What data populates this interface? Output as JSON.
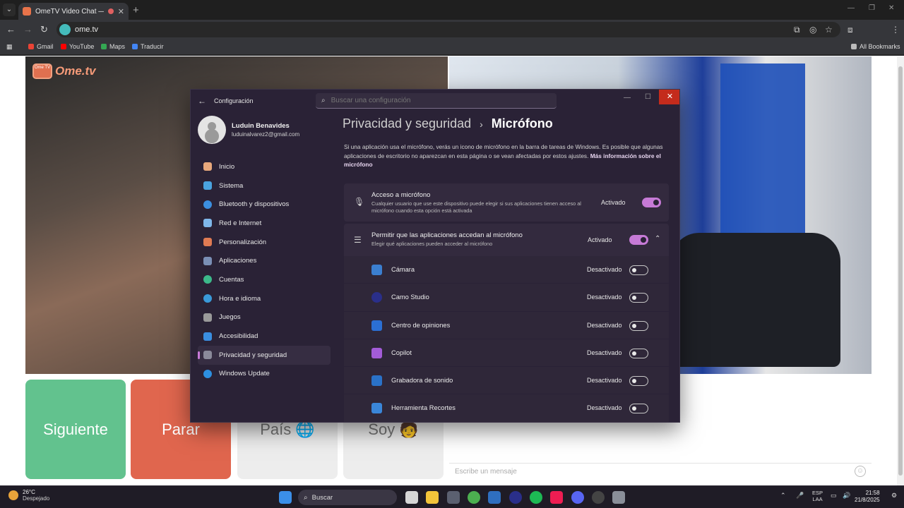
{
  "browser": {
    "tab_title": "OmeTV Video Chat — Om",
    "url": "ome.tv",
    "bookmarks": [
      {
        "label": "Gmail",
        "color": "#ea4335"
      },
      {
        "label": "YouTube",
        "color": "#ff0000"
      },
      {
        "label": "Maps",
        "color": "#34a853"
      },
      {
        "label": "Traducir",
        "color": "#4285f4"
      }
    ],
    "all_bookmarks": "All Bookmarks",
    "profile_initial": "L"
  },
  "site": {
    "logo_tv": "Ome TV",
    "logo_text": "Ome.tv",
    "buttons": {
      "next": "Siguiente",
      "stop": "Parar",
      "country": "País 🌐",
      "gender": "Soy 🧑"
    },
    "message_placeholder": "Escribe un mensaje"
  },
  "settings": {
    "app_title": "Configuración",
    "search_placeholder": "Buscar una configuración",
    "user": {
      "name": "Luduin Benavides",
      "email": "luduinalvarez2@gmail.com"
    },
    "nav": [
      {
        "label": "Inicio",
        "color": "#e8a87c"
      },
      {
        "label": "Sistema",
        "color": "#4aa3df"
      },
      {
        "label": "Bluetooth y dispositivos",
        "color": "#3c8fe0"
      },
      {
        "label": "Red e Internet",
        "color": "#7fb7ea"
      },
      {
        "label": "Personalización",
        "color": "#e07b53"
      },
      {
        "label": "Aplicaciones",
        "color": "#7a8fb5"
      },
      {
        "label": "Cuentas",
        "color": "#3cb98a"
      },
      {
        "label": "Hora e idioma",
        "color": "#3a9ad9"
      },
      {
        "label": "Juegos",
        "color": "#9a9a9a"
      },
      {
        "label": "Accesibilidad",
        "color": "#3a8ee0"
      },
      {
        "label": "Privacidad y seguridad",
        "color": "#8a8a9a",
        "active": true
      },
      {
        "label": "Windows Update",
        "color": "#2d8fe0"
      }
    ],
    "breadcrumb": {
      "parent": "Privacidad y seguridad",
      "separator": "›",
      "current": "Micrófono"
    },
    "description": "Si una aplicación usa el micrófono, verás un icono de micrófono en la barra de tareas de Windows. Es posible que algunas aplicaciones de escritorio no aparezcan en esta página o se vean afectadas por estos ajustes.",
    "description_link": "Más información sobre el micrófono",
    "mic_access": {
      "title": "Acceso a micrófono",
      "subtitle": "Cualquier usuario que use este dispositivo puede elegir si sus aplicaciones tienen acceso al micrófono cuando esta opción está activada",
      "state": "Activado",
      "on": true
    },
    "allow_apps": {
      "title": "Permitir que las aplicaciones accedan al micrófono",
      "subtitle": "Elegir qué aplicaciones pueden acceder al micrófono",
      "state": "Activado",
      "on": true
    },
    "apps": [
      {
        "name": "Cámara",
        "state": "Desactivado",
        "color": "#3b7fd0"
      },
      {
        "name": "Camo Studio",
        "state": "Desactivado",
        "color": "#2a2f8a"
      },
      {
        "name": "Centro de opiniones",
        "state": "Desactivado",
        "color": "#2b6fd3"
      },
      {
        "name": "Copilot",
        "state": "Desactivado",
        "color": "#a35cd8"
      },
      {
        "name": "Grabadora de sonido",
        "state": "Desactivado",
        "color": "#2a72c8"
      },
      {
        "name": "Herramienta Recortes",
        "state": "Desactivado",
        "color": "#3a86d9"
      }
    ]
  },
  "taskbar": {
    "temp": "26°C",
    "weather": "Despejado",
    "search": "Buscar",
    "lang_top": "ESP",
    "lang_bottom": "LAA",
    "time": "21:58",
    "date": "21/8/2025"
  }
}
